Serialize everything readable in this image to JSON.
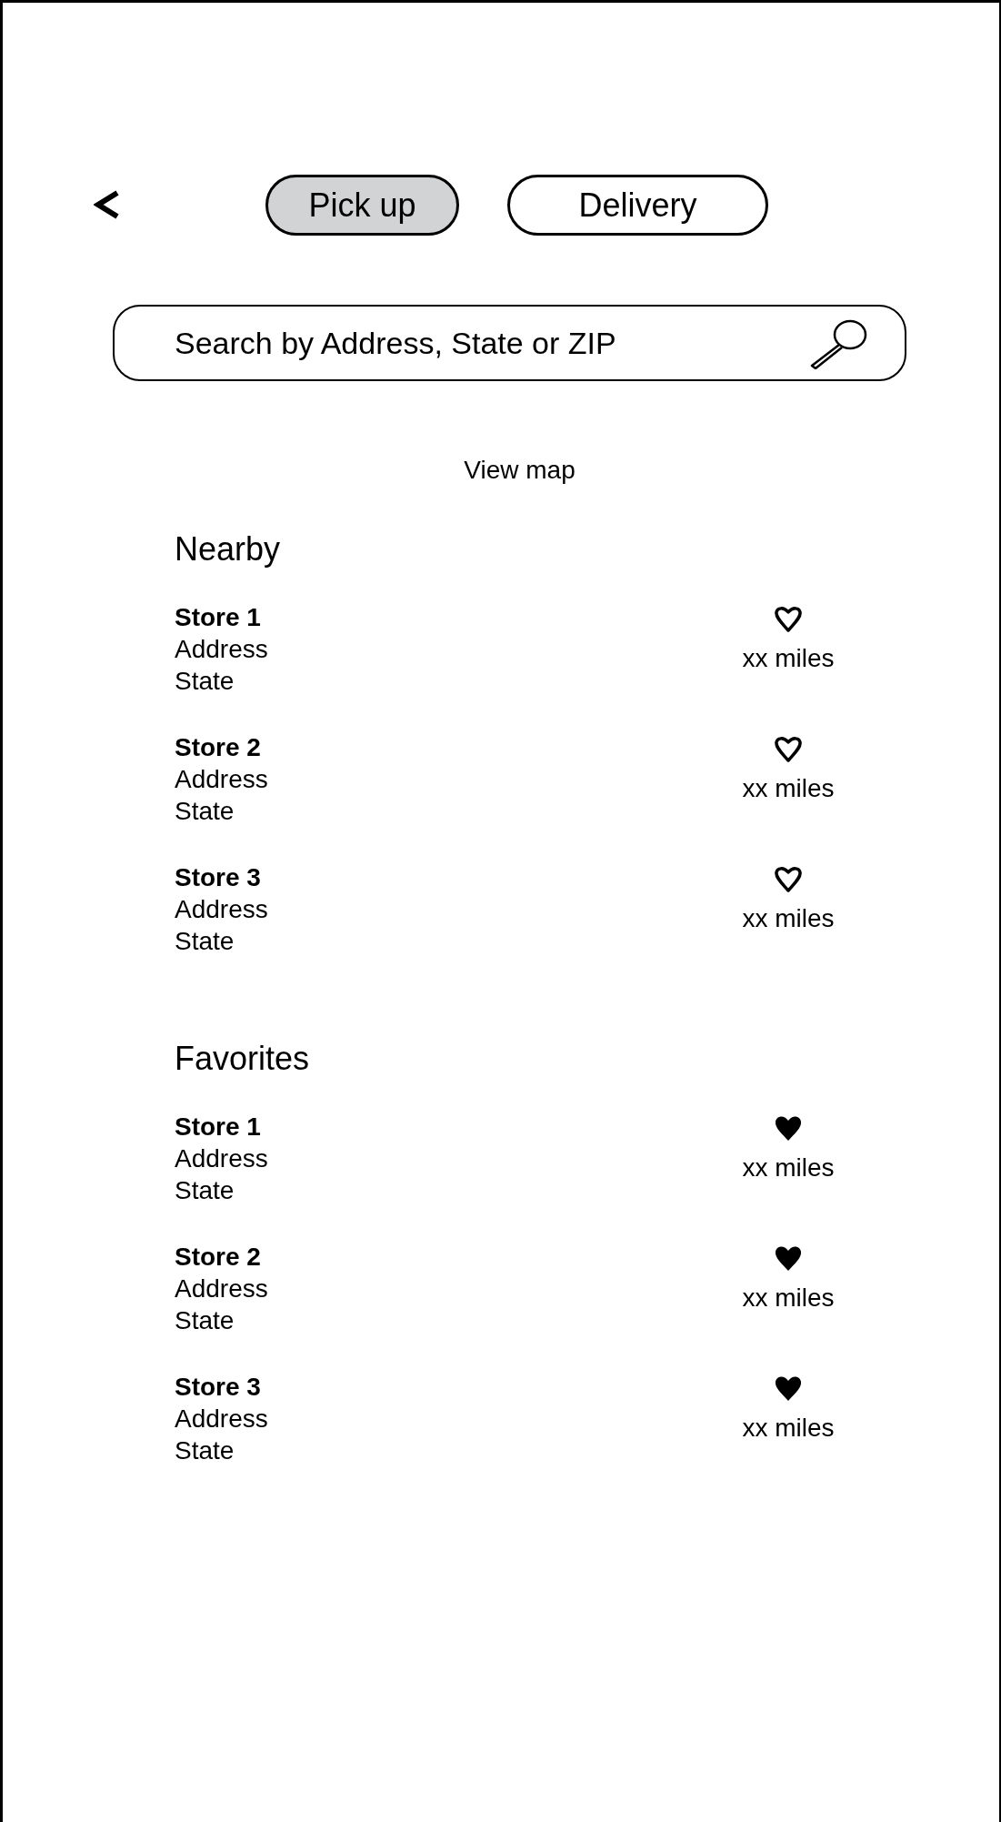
{
  "tabs": [
    {
      "label": "Pick up",
      "selected": true
    },
    {
      "label": "Delivery",
      "selected": false
    }
  ],
  "search": {
    "placeholder": "Search by Address, State or ZIP"
  },
  "view_map": "View map",
  "sections": [
    {
      "title": "Nearby",
      "stores": [
        {
          "name": "Store 1",
          "address": "Address",
          "state": "State",
          "favorite": false,
          "distance": "xx miles"
        },
        {
          "name": "Store 2",
          "address": "Address",
          "state": "State",
          "favorite": false,
          "distance": "xx miles"
        },
        {
          "name": "Store 3",
          "address": "Address",
          "state": "State",
          "favorite": false,
          "distance": "xx miles"
        }
      ]
    },
    {
      "title": "Favorites",
      "stores": [
        {
          "name": "Store 1",
          "address": "Address",
          "state": "State",
          "favorite": true,
          "distance": "xx miles"
        },
        {
          "name": "Store 2",
          "address": "Address",
          "state": "State",
          "favorite": true,
          "distance": "xx miles"
        },
        {
          "name": "Store 3",
          "address": "Address",
          "state": "State",
          "favorite": true,
          "distance": "xx miles"
        }
      ]
    }
  ]
}
